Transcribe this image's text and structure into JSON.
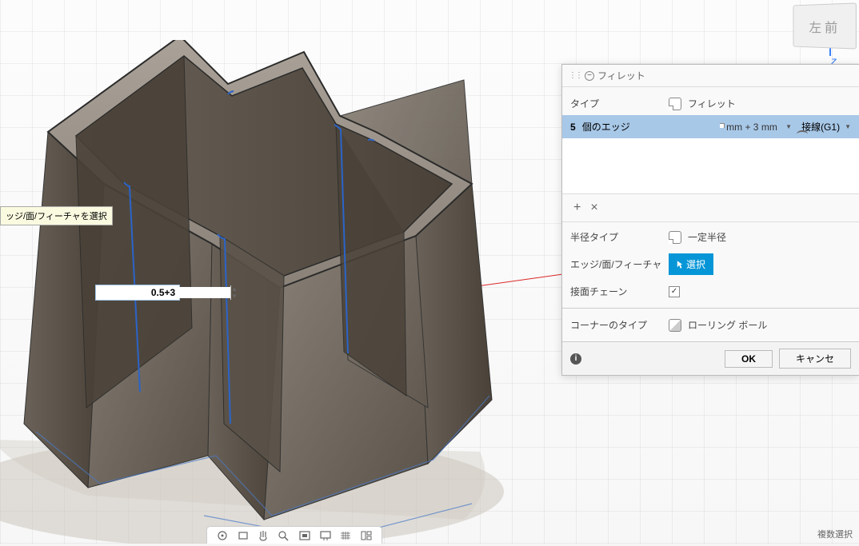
{
  "viewport": {
    "tooltip": "ッジ/面/フィーチャを選択",
    "dimension_value": "0.5+3",
    "axis_label": "z",
    "view_cube": {
      "face1": "左",
      "face2": "前"
    }
  },
  "panel": {
    "title": "フィレット",
    "rows": {
      "type_label": "タイプ",
      "type_value": "フィレット",
      "edge_count": "5",
      "edge_label": "個のエッジ",
      "radius_value": "mm + 3 mm",
      "tangent_value": "接線(G1)",
      "radius_type_label": "半径タイプ",
      "radius_type_value": "一定半径",
      "edge_select_label": "エッジ/面/フィーチャ",
      "select_button": "選択",
      "tangent_chain_label": "接面チェーン",
      "corner_type_label": "コーナーのタイプ",
      "corner_type_value": "ローリング ボール"
    },
    "footer": {
      "ok": "OK",
      "cancel": "キャンセ"
    }
  },
  "status": {
    "multi_select": "複数選択"
  }
}
